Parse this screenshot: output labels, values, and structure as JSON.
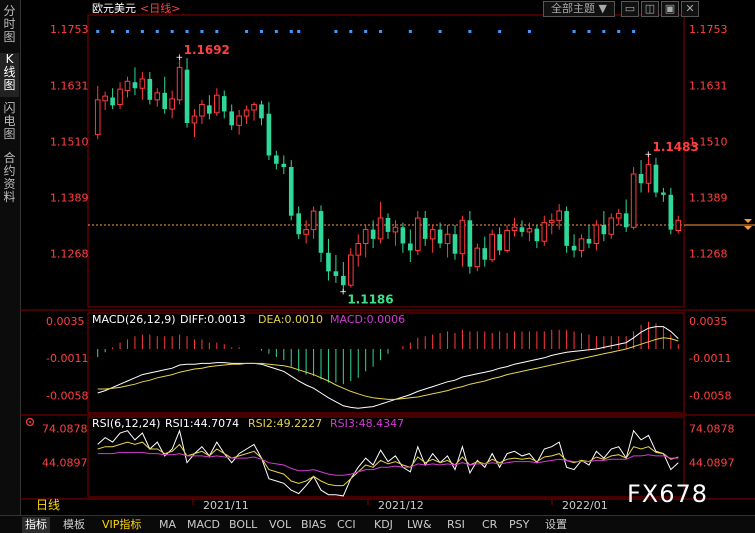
{
  "side_buttons": [
    "分时图",
    "K线图",
    "闪电图",
    "合约资料"
  ],
  "top_controls": {
    "theme_label": "全部主题",
    "theme_arrow": "▼"
  },
  "chart_data": [
    {
      "type": "candlestick",
      "title_prefix": "欧元美元",
      "period": "<日线>",
      "y_ticks": [
        1.1753,
        1.1631,
        1.151,
        1.1389,
        1.1268
      ],
      "y_tick_labels": [
        "1.1753",
        "1.1631",
        "1.1510",
        "1.1389",
        "1.1268"
      ],
      "ylim": [
        1.1153,
        1.1783
      ],
      "current_price": 1.133,
      "annotations": [
        {
          "text": "1.1692",
          "value": 1.1692,
          "type": "high"
        },
        {
          "text": "1.1186",
          "value": 1.1186,
          "type": "low"
        },
        {
          "text": "1.1483",
          "value": 1.1483,
          "type": "high"
        }
      ],
      "candles": [
        {
          "o": 1.1525,
          "h": 1.163,
          "l": 1.1515,
          "c": 1.16
        },
        {
          "o": 1.1598,
          "h": 1.1618,
          "l": 1.1578,
          "c": 1.1608
        },
        {
          "o": 1.1605,
          "h": 1.1625,
          "l": 1.158,
          "c": 1.1588
        },
        {
          "o": 1.159,
          "h": 1.1638,
          "l": 1.158,
          "c": 1.1623
        },
        {
          "o": 1.162,
          "h": 1.165,
          "l": 1.1605,
          "c": 1.164
        },
        {
          "o": 1.1638,
          "h": 1.167,
          "l": 1.161,
          "c": 1.1625
        },
        {
          "o": 1.1625,
          "h": 1.166,
          "l": 1.16,
          "c": 1.1645
        },
        {
          "o": 1.1645,
          "h": 1.166,
          "l": 1.159,
          "c": 1.16
        },
        {
          "o": 1.16,
          "h": 1.1625,
          "l": 1.1585,
          "c": 1.1615
        },
        {
          "o": 1.1615,
          "h": 1.165,
          "l": 1.157,
          "c": 1.158
        },
        {
          "o": 1.158,
          "h": 1.162,
          "l": 1.156,
          "c": 1.1602
        },
        {
          "o": 1.16,
          "h": 1.1692,
          "l": 1.159,
          "c": 1.167
        },
        {
          "o": 1.1665,
          "h": 1.169,
          "l": 1.154,
          "c": 1.155
        },
        {
          "o": 1.155,
          "h": 1.158,
          "l": 1.152,
          "c": 1.1565
        },
        {
          "o": 1.1565,
          "h": 1.16,
          "l": 1.1548,
          "c": 1.159
        },
        {
          "o": 1.1588,
          "h": 1.161,
          "l": 1.1558,
          "c": 1.157
        },
        {
          "o": 1.1572,
          "h": 1.1625,
          "l": 1.1565,
          "c": 1.161
        },
        {
          "o": 1.1608,
          "h": 1.162,
          "l": 1.156,
          "c": 1.1575
        },
        {
          "o": 1.1575,
          "h": 1.159,
          "l": 1.1535,
          "c": 1.1545
        },
        {
          "o": 1.1545,
          "h": 1.1578,
          "l": 1.1525,
          "c": 1.1565
        },
        {
          "o": 1.1565,
          "h": 1.1588,
          "l": 1.1548,
          "c": 1.1578
        },
        {
          "o": 1.1578,
          "h": 1.1595,
          "l": 1.1555,
          "c": 1.159
        },
        {
          "o": 1.159,
          "h": 1.1598,
          "l": 1.1545,
          "c": 1.156
        },
        {
          "o": 1.157,
          "h": 1.1595,
          "l": 1.147,
          "c": 1.148
        },
        {
          "o": 1.148,
          "h": 1.149,
          "l": 1.145,
          "c": 1.1462
        },
        {
          "o": 1.1462,
          "h": 1.148,
          "l": 1.144,
          "c": 1.1455
        },
        {
          "o": 1.1455,
          "h": 1.147,
          "l": 1.134,
          "c": 1.135
        },
        {
          "o": 1.1355,
          "h": 1.137,
          "l": 1.13,
          "c": 1.131
        },
        {
          "o": 1.131,
          "h": 1.134,
          "l": 1.129,
          "c": 1.132
        },
        {
          "o": 1.132,
          "h": 1.137,
          "l": 1.13,
          "c": 1.136
        },
        {
          "o": 1.136,
          "h": 1.1372,
          "l": 1.125,
          "c": 1.127
        },
        {
          "o": 1.127,
          "h": 1.13,
          "l": 1.121,
          "c": 1.123
        },
        {
          "o": 1.123,
          "h": 1.1265,
          "l": 1.1205,
          "c": 1.122
        },
        {
          "o": 1.122,
          "h": 1.125,
          "l": 1.1186,
          "c": 1.12
        },
        {
          "o": 1.12,
          "h": 1.128,
          "l": 1.1195,
          "c": 1.1265
        },
        {
          "o": 1.1265,
          "h": 1.131,
          "l": 1.124,
          "c": 1.129
        },
        {
          "o": 1.129,
          "h": 1.133,
          "l": 1.126,
          "c": 1.132
        },
        {
          "o": 1.132,
          "h": 1.134,
          "l": 1.128,
          "c": 1.13
        },
        {
          "o": 1.13,
          "h": 1.138,
          "l": 1.129,
          "c": 1.1345
        },
        {
          "o": 1.1345,
          "h": 1.1355,
          "l": 1.13,
          "c": 1.1315
        },
        {
          "o": 1.1315,
          "h": 1.134,
          "l": 1.1285,
          "c": 1.1325
        },
        {
          "o": 1.1325,
          "h": 1.1335,
          "l": 1.127,
          "c": 1.129
        },
        {
          "o": 1.129,
          "h": 1.132,
          "l": 1.125,
          "c": 1.1275
        },
        {
          "o": 1.1275,
          "h": 1.136,
          "l": 1.1265,
          "c": 1.1345
        },
        {
          "o": 1.1345,
          "h": 1.136,
          "l": 1.1285,
          "c": 1.13
        },
        {
          "o": 1.13,
          "h": 1.133,
          "l": 1.127,
          "c": 1.132
        },
        {
          "o": 1.132,
          "h": 1.1335,
          "l": 1.128,
          "c": 1.129
        },
        {
          "o": 1.129,
          "h": 1.133,
          "l": 1.126,
          "c": 1.131
        },
        {
          "o": 1.131,
          "h": 1.133,
          "l": 1.1255,
          "c": 1.1268
        },
        {
          "o": 1.1268,
          "h": 1.135,
          "l": 1.124,
          "c": 1.134
        },
        {
          "o": 1.134,
          "h": 1.136,
          "l": 1.1225,
          "c": 1.124
        },
        {
          "o": 1.124,
          "h": 1.129,
          "l": 1.123,
          "c": 1.128
        },
        {
          "o": 1.128,
          "h": 1.1305,
          "l": 1.124,
          "c": 1.1255
        },
        {
          "o": 1.1255,
          "h": 1.132,
          "l": 1.125,
          "c": 1.131
        },
        {
          "o": 1.131,
          "h": 1.1325,
          "l": 1.1265,
          "c": 1.1275
        },
        {
          "o": 1.1275,
          "h": 1.133,
          "l": 1.127,
          "c": 1.1318
        },
        {
          "o": 1.1318,
          "h": 1.1345,
          "l": 1.1305,
          "c": 1.1325
        },
        {
          "o": 1.1325,
          "h": 1.134,
          "l": 1.1305,
          "c": 1.1315
        },
        {
          "o": 1.1315,
          "h": 1.1335,
          "l": 1.1295,
          "c": 1.1322
        },
        {
          "o": 1.1322,
          "h": 1.133,
          "l": 1.128,
          "c": 1.1295
        },
        {
          "o": 1.1295,
          "h": 1.135,
          "l": 1.1285,
          "c": 1.1335
        },
        {
          "o": 1.1335,
          "h": 1.1355,
          "l": 1.131,
          "c": 1.134
        },
        {
          "o": 1.134,
          "h": 1.1375,
          "l": 1.132,
          "c": 1.136
        },
        {
          "o": 1.136,
          "h": 1.137,
          "l": 1.127,
          "c": 1.1285
        },
        {
          "o": 1.1285,
          "h": 1.131,
          "l": 1.126,
          "c": 1.1275
        },
        {
          "o": 1.1275,
          "h": 1.131,
          "l": 1.126,
          "c": 1.13
        },
        {
          "o": 1.13,
          "h": 1.133,
          "l": 1.128,
          "c": 1.129
        },
        {
          "o": 1.129,
          "h": 1.134,
          "l": 1.1275,
          "c": 1.133
        },
        {
          "o": 1.133,
          "h": 1.136,
          "l": 1.1295,
          "c": 1.131
        },
        {
          "o": 1.131,
          "h": 1.1355,
          "l": 1.13,
          "c": 1.1345
        },
        {
          "o": 1.1345,
          "h": 1.1365,
          "l": 1.133,
          "c": 1.1355
        },
        {
          "o": 1.1355,
          "h": 1.1385,
          "l": 1.1315,
          "c": 1.1325
        },
        {
          "o": 1.1325,
          "h": 1.1455,
          "l": 1.132,
          "c": 1.144
        },
        {
          "o": 1.144,
          "h": 1.147,
          "l": 1.14,
          "c": 1.142
        },
        {
          "o": 1.142,
          "h": 1.1483,
          "l": 1.14,
          "c": 1.146
        },
        {
          "o": 1.146,
          "h": 1.1475,
          "l": 1.139,
          "c": 1.14
        },
        {
          "o": 1.14,
          "h": 1.141,
          "l": 1.138,
          "c": 1.1395
        },
        {
          "o": 1.1395,
          "h": 1.141,
          "l": 1.131,
          "c": 1.132
        },
        {
          "o": 1.1318,
          "h": 1.135,
          "l": 1.1312,
          "c": 1.134
        }
      ]
    },
    {
      "type": "line",
      "indicator": "MACD",
      "header": {
        "name": "MACD(26,12,9)",
        "diff": "DIFF:0.0013",
        "dea": "DEA:0.0010",
        "macd": "MACD:0.0006"
      },
      "y_tick_labels": [
        "0.0035",
        "-0.0011",
        "-0.0058"
      ],
      "y_ticks": [
        0.0035,
        -0.0011,
        -0.0058
      ],
      "ylim": [
        -0.008,
        0.0045
      ],
      "x_labels": [
        "2021/11",
        "2021/12",
        "2022/01"
      ],
      "series": [
        {
          "name": "DIFF",
          "values": [
            -0.0055,
            -0.0052,
            -0.0048,
            -0.0044,
            -0.004,
            -0.0036,
            -0.0032,
            -0.003,
            -0.0028,
            -0.0026,
            -0.0024,
            -0.002,
            -0.0019,
            -0.0019,
            -0.0018,
            -0.0018,
            -0.0017,
            -0.0017,
            -0.0018,
            -0.0018,
            -0.0018,
            -0.0018,
            -0.0019,
            -0.0022,
            -0.0025,
            -0.0028,
            -0.0034,
            -0.004,
            -0.0045,
            -0.0049,
            -0.0055,
            -0.0061,
            -0.0066,
            -0.0071,
            -0.0073,
            -0.0074,
            -0.0073,
            -0.0072,
            -0.0069,
            -0.0066,
            -0.0063,
            -0.006,
            -0.0057,
            -0.0053,
            -0.005,
            -0.0047,
            -0.0044,
            -0.0041,
            -0.0039,
            -0.0035,
            -0.0033,
            -0.0031,
            -0.0029,
            -0.0027,
            -0.0024,
            -0.0022,
            -0.0019,
            -0.0017,
            -0.0015,
            -0.0013,
            -0.0011,
            -0.0008,
            -0.0006,
            -0.0004,
            -0.0003,
            -0.0002,
            -0.0001,
            0.0,
            0.0002,
            0.0004,
            0.0006,
            0.0008,
            0.0014,
            0.0021,
            0.0026,
            0.0028,
            0.0028,
            0.0022,
            0.0013
          ]
        },
        {
          "name": "DEA",
          "values": [
            -0.005,
            -0.005,
            -0.0049,
            -0.0048,
            -0.0046,
            -0.0044,
            -0.0041,
            -0.0039,
            -0.0036,
            -0.0034,
            -0.0032,
            -0.0029,
            -0.0027,
            -0.0025,
            -0.0024,
            -0.0022,
            -0.0021,
            -0.002,
            -0.0019,
            -0.0019,
            -0.0018,
            -0.0018,
            -0.0018,
            -0.0019,
            -0.002,
            -0.0021,
            -0.0023,
            -0.0026,
            -0.0029,
            -0.0032,
            -0.0036,
            -0.004,
            -0.0045,
            -0.0049,
            -0.0053,
            -0.0056,
            -0.0059,
            -0.0061,
            -0.0062,
            -0.0063,
            -0.0063,
            -0.0062,
            -0.0061,
            -0.006,
            -0.0058,
            -0.0056,
            -0.0054,
            -0.0052,
            -0.0049,
            -0.0047,
            -0.0044,
            -0.0042,
            -0.004,
            -0.0037,
            -0.0035,
            -0.0032,
            -0.003,
            -0.0028,
            -0.0026,
            -0.0024,
            -0.0022,
            -0.002,
            -0.0018,
            -0.0016,
            -0.0014,
            -0.0012,
            -0.001,
            -0.0008,
            -0.0006,
            -0.0004,
            -0.0002,
            0.0,
            0.0003,
            0.0006,
            0.0009,
            0.0012,
            0.0014,
            0.0013,
            0.001
          ]
        }
      ]
    },
    {
      "type": "line",
      "indicator": "RSI",
      "header": {
        "name": "RSI(6,12,24)",
        "rsi1": "RSI1:44.7074",
        "rsi2": "RSI2:49.2227",
        "rsi3": "RSI3:48.4347"
      },
      "y_tick_labels": [
        "74.0878",
        "44.0897"
      ],
      "y_ticks": [
        74.0878,
        44.0897
      ],
      "ylim": [
        14,
        84
      ],
      "series": [
        {
          "name": "RSI1",
          "values": [
            60,
            66,
            62,
            70,
            72,
            64,
            70,
            56,
            62,
            50,
            56,
            72,
            44,
            52,
            58,
            50,
            62,
            52,
            44,
            52,
            56,
            60,
            48,
            30,
            28,
            26,
            20,
            17,
            24,
            32,
            20,
            16,
            16,
            15,
            30,
            40,
            48,
            42,
            55,
            45,
            50,
            40,
            36,
            58,
            42,
            52,
            44,
            50,
            38,
            58,
            35,
            46,
            40,
            52,
            40,
            52,
            54,
            50,
            52,
            44,
            56,
            58,
            62,
            40,
            38,
            46,
            42,
            54,
            48,
            56,
            58,
            48,
            72,
            64,
            68,
            54,
            52,
            38,
            44
          ]
        },
        {
          "name": "RSI2",
          "values": [
            56,
            58,
            58,
            60,
            62,
            60,
            62,
            56,
            56,
            52,
            54,
            60,
            50,
            52,
            54,
            50,
            56,
            52,
            48,
            50,
            52,
            54,
            48,
            38,
            36,
            34,
            28,
            26,
            28,
            32,
            28,
            25,
            24,
            24,
            30,
            36,
            42,
            40,
            46,
            43,
            45,
            42,
            40,
            49,
            44,
            47,
            44,
            46,
            42,
            49,
            42,
            45,
            43,
            47,
            44,
            47,
            48,
            47,
            48,
            45,
            49,
            50,
            52,
            46,
            44,
            46,
            45,
            49,
            47,
            50,
            51,
            48,
            58,
            56,
            58,
            53,
            52,
            47,
            49
          ]
        },
        {
          "name": "RSI3",
          "values": [
            52,
            52,
            52,
            53,
            53,
            53,
            53,
            52,
            52,
            51,
            51,
            52,
            50,
            50,
            50,
            49,
            50,
            49,
            48,
            48,
            48,
            49,
            47,
            44,
            43,
            42,
            39,
            37,
            37,
            38,
            36,
            34,
            33,
            33,
            34,
            36,
            38,
            38,
            40,
            40,
            41,
            40,
            40,
            43,
            42,
            43,
            42,
            43,
            42,
            44,
            42,
            43,
            43,
            44,
            43,
            44,
            45,
            45,
            45,
            44,
            45,
            46,
            47,
            46,
            45,
            45,
            45,
            46,
            46,
            47,
            47,
            47,
            50,
            50,
            51,
            50,
            50,
            48,
            48
          ]
        }
      ]
    }
  ],
  "bottom_tabs": [
    "日线",
    "指标",
    "模板",
    "VIP指标",
    "MA",
    "MACD",
    "BOLL",
    "VOL",
    "BIAS",
    "CCI",
    "KDJ",
    "LW&",
    "RSI",
    "CR",
    "PSY",
    "设置"
  ],
  "watermark": "FX678",
  "colors": {
    "up": "#ff3b3b",
    "down": "#2fd89a",
    "price_label": "#ff4040",
    "low_label": "#3ee08a",
    "dea": "#e6d44a",
    "macd": "#d23cd2",
    "rsi2": "#e6d44a",
    "rsi3": "#d23cd2",
    "last_price_line": "#ff9a3c",
    "dot_marker": "#3c9cff"
  },
  "icons": {
    "settings_marker": "gear-icon"
  }
}
